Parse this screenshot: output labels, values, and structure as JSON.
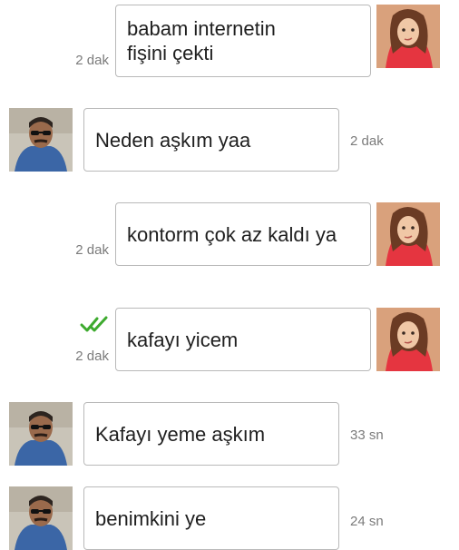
{
  "conversation": {
    "messages": [
      {
        "side": "out",
        "text": "babam internetin fişini çekti",
        "time": "2 dak",
        "read": false
      },
      {
        "side": "in",
        "text": "Neden aşkım yaa",
        "time": "2 dak"
      },
      {
        "side": "out",
        "text": "kontorm çok az kaldı ya",
        "time": "2 dak",
        "read": false
      },
      {
        "side": "out",
        "text": "kafayı yicem",
        "time": "2 dak",
        "read": true
      },
      {
        "side": "in",
        "text": "Kafayı yeme aşkım",
        "time": "33 sn"
      },
      {
        "side": "in",
        "text": "benimkini ye",
        "time": "24 sn"
      }
    ]
  },
  "colors": {
    "read_check": "#3daa2e",
    "girl_background": "#e7b38f",
    "girl_top": "#e53540",
    "man_background": "#c9c4b8",
    "man_shirt": "#3b66a6"
  },
  "icons": {
    "read_receipt": "double-check-icon",
    "sender_avatar": "girl-avatar",
    "recipient_avatar": "man-avatar"
  }
}
